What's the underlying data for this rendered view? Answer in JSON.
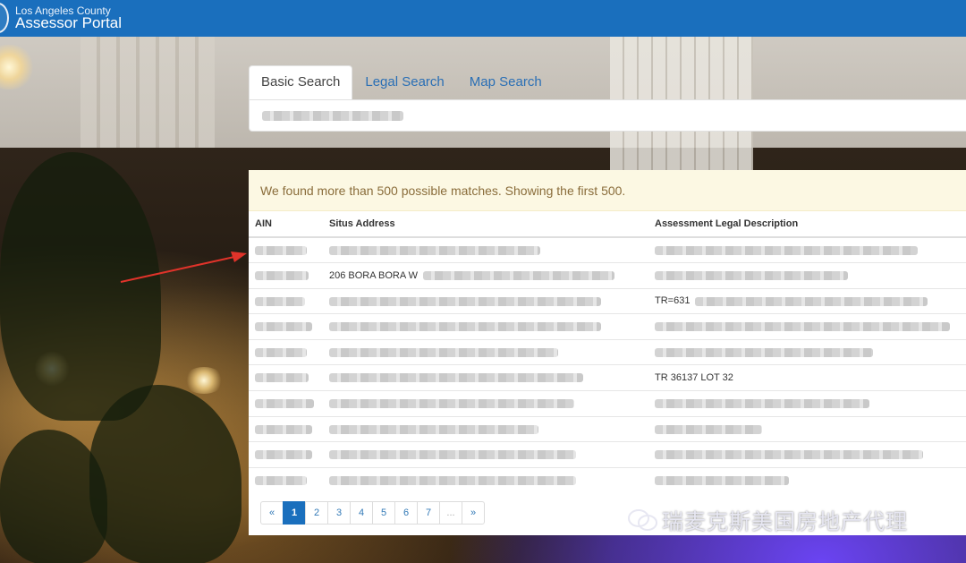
{
  "header": {
    "org": "Los Angeles County",
    "title": "Assessor Portal"
  },
  "tabs": [
    {
      "label": "Basic Search",
      "active": true
    },
    {
      "label": "Legal Search",
      "active": false
    },
    {
      "label": "Map Search",
      "active": false
    }
  ],
  "search": {
    "value": ""
  },
  "alert": {
    "message": "We found more than 500 possible matches. Showing the first 500."
  },
  "table": {
    "columns": [
      "AIN",
      "Situs Address",
      "Assessment Legal Description"
    ],
    "rows": [
      [
        "",
        "",
        ""
      ],
      [
        "",
        "206 BORA BORA W",
        ""
      ],
      [
        "",
        "",
        "TR=631"
      ],
      [
        "",
        "",
        ""
      ],
      [
        "",
        "",
        ""
      ],
      [
        "",
        "",
        "TR 36137 LOT 32"
      ],
      [
        "",
        "",
        ""
      ],
      [
        "",
        "",
        ""
      ],
      [
        "",
        "",
        ""
      ],
      [
        "",
        "",
        ""
      ]
    ]
  },
  "pagination": {
    "prev": "«",
    "pages": [
      "1",
      "2",
      "3",
      "4",
      "5",
      "6",
      "7"
    ],
    "active": "1",
    "ellipsis": "...",
    "next": "»"
  },
  "watermark": {
    "text": "瑞麦克斯美国房地产代理"
  },
  "colors": {
    "header": "#1a6fbd",
    "accent": "#337ab7",
    "alert_bg": "#fcf8e3",
    "alert_text": "#8a6d3b",
    "arrow": "#e0332a"
  },
  "icons": {
    "seal": "county-seal-icon",
    "watermark": "wechat-icon"
  }
}
